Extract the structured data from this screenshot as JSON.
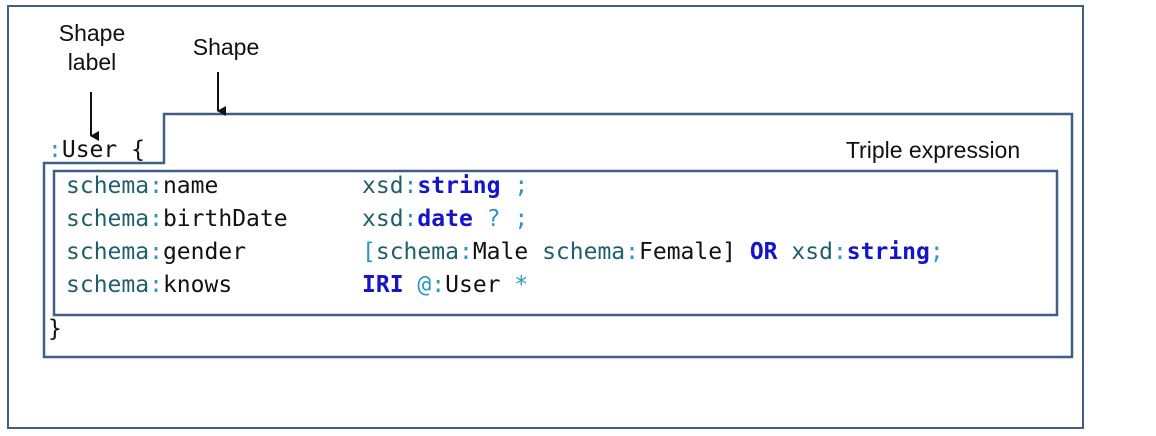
{
  "labels": {
    "shape_label": "Shape label",
    "shape": "Shape",
    "triple_expression": "Triple expression"
  },
  "code": {
    "shape_colon": ":",
    "shape_name": "User",
    "open_brace": " {",
    "close_brace": "}",
    "rows": [
      {
        "prefix": "schema",
        "local": "name",
        "type_prefix": "xsd",
        "type": "string",
        "tail": " ;"
      },
      {
        "prefix": "schema",
        "local": "birthDate",
        "type_prefix": "xsd",
        "type": "date",
        "tail": " ? ;"
      },
      {
        "prefix": "schema",
        "local": "gender"
      },
      {
        "prefix": "schema",
        "local": "knows"
      }
    ],
    "gender_value": {
      "open": "[",
      "v1_prefix": "schema",
      "v1_local": "Male",
      "v2_prefix": "schema",
      "v2_local": "Female",
      "close": "]",
      "or_kw": "OR",
      "type_prefix": "xsd",
      "type": "string",
      "tail": ";"
    },
    "knows_value": {
      "iri_kw": "IRI",
      "at": "@",
      "ref_colon": ":",
      "ref_name": "User",
      "star": " *"
    }
  },
  "colors": {
    "border": "#3f5f86",
    "namespace": "#1f5f6b",
    "colon": "#2a98c2",
    "keyword": "#1414c8"
  }
}
